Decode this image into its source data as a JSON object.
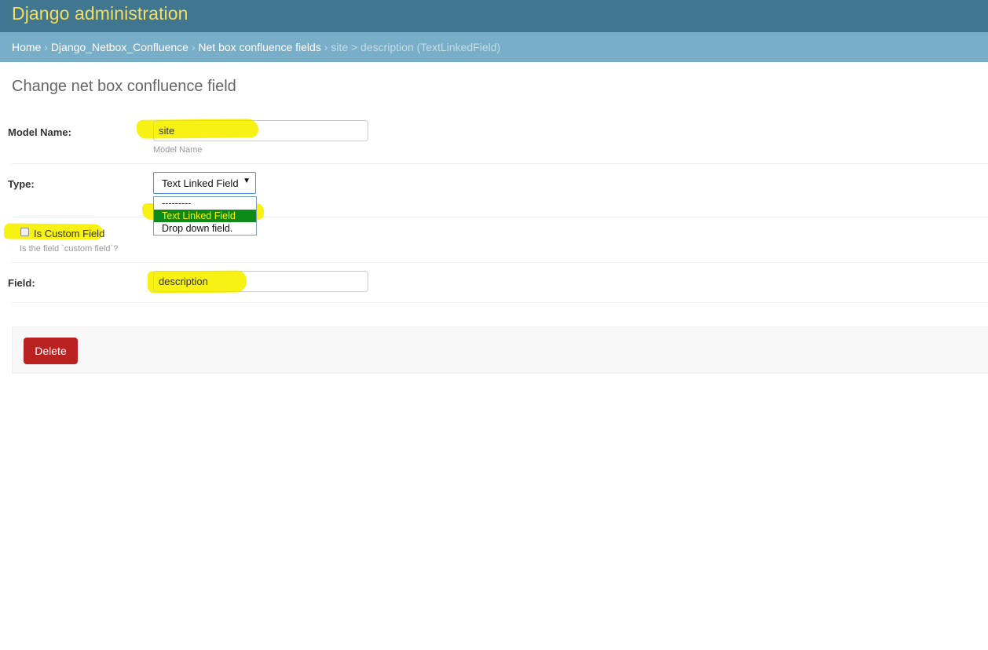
{
  "header": {
    "branding": "Django administration"
  },
  "breadcrumbs": {
    "home": "Home",
    "app": "Django_Netbox_Confluence",
    "model": "Net box confluence fields",
    "current": "site > description (TextLinkedField)",
    "separator": "›"
  },
  "page_title": "Change net box confluence field",
  "form": {
    "model_name": {
      "label": "Model Name:",
      "value": "site",
      "help": "Model Name"
    },
    "type": {
      "label": "Type:",
      "selected": "Text Linked Field",
      "options": [
        "---------",
        "Text Linked Field",
        "Drop down field."
      ],
      "selected_index": 1
    },
    "is_custom_field": {
      "label": "Is Custom Field",
      "checked": false,
      "help": "Is the field `custom field`?"
    },
    "field": {
      "label": "Field:",
      "value": "description"
    }
  },
  "actions": {
    "delete_label": "Delete"
  },
  "colors": {
    "header_bg": "#417690",
    "breadcrumb_bg": "#79aec8",
    "branding_text": "#f5dd5d",
    "delete_bg": "#ba2121",
    "highlighter": "#f7f000",
    "selected_option_bg": "#0d8a1a"
  },
  "icons": {
    "select_arrow": "caret-down-icon"
  }
}
